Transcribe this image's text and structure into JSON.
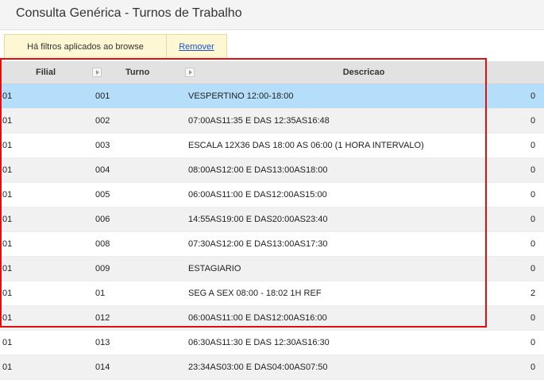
{
  "window": {
    "title": "Consulta Genérica - Turnos de Trabalho"
  },
  "filter": {
    "message": "Há filtros aplicados ao browse",
    "remove_label": "Remover"
  },
  "grid": {
    "columns": [
      "Filial",
      "Turno",
      "Descricao"
    ],
    "rows": [
      {
        "filial": "01",
        "turno": "001",
        "descricao": "VESPERTINO 12:00-18:00",
        "extra": "0",
        "selected": true
      },
      {
        "filial": "01",
        "turno": "002",
        "descricao": "07:00AS11:35 E DAS 12:35AS16:48",
        "extra": "0"
      },
      {
        "filial": "01",
        "turno": "003",
        "descricao": "ESCALA 12X36 DAS 18:00 AS 06:00 (1 HORA INTERVALO)",
        "extra": "0"
      },
      {
        "filial": "01",
        "turno": "004",
        "descricao": "08:00AS12:00 E DAS13:00AS18:00",
        "extra": "0"
      },
      {
        "filial": "01",
        "turno": "005",
        "descricao": "06:00AS11:00 E DAS12:00AS15:00",
        "extra": "0"
      },
      {
        "filial": "01",
        "turno": "006",
        "descricao": "14:55AS19:00 E DAS20:00AS23:40",
        "extra": "0"
      },
      {
        "filial": "01",
        "turno": "008",
        "descricao": "07:30AS12:00 E DAS13:00AS17:30",
        "extra": "0"
      },
      {
        "filial": "01",
        "turno": "009",
        "descricao": "ESTAGIARIO",
        "extra": "0"
      },
      {
        "filial": "01",
        "turno": "01",
        "descricao": "SEG A SEX 08:00 - 18:02 1H REF",
        "extra": "2"
      },
      {
        "filial": "01",
        "turno": "012",
        "descricao": "06:00AS11:00 E DAS12:00AS16:00",
        "extra": "0"
      },
      {
        "filial": "01",
        "turno": "013",
        "descricao": "06:30AS11:30 E DAS 12:30AS16:30",
        "extra": "0"
      },
      {
        "filial": "01",
        "turno": "014",
        "descricao": "23:34AS03:00 E DAS04:00AS07:50",
        "extra": "0"
      }
    ]
  },
  "colors": {
    "highlight": "#e01010",
    "selected_row": "#b5defa",
    "link": "#1a4fd1"
  }
}
